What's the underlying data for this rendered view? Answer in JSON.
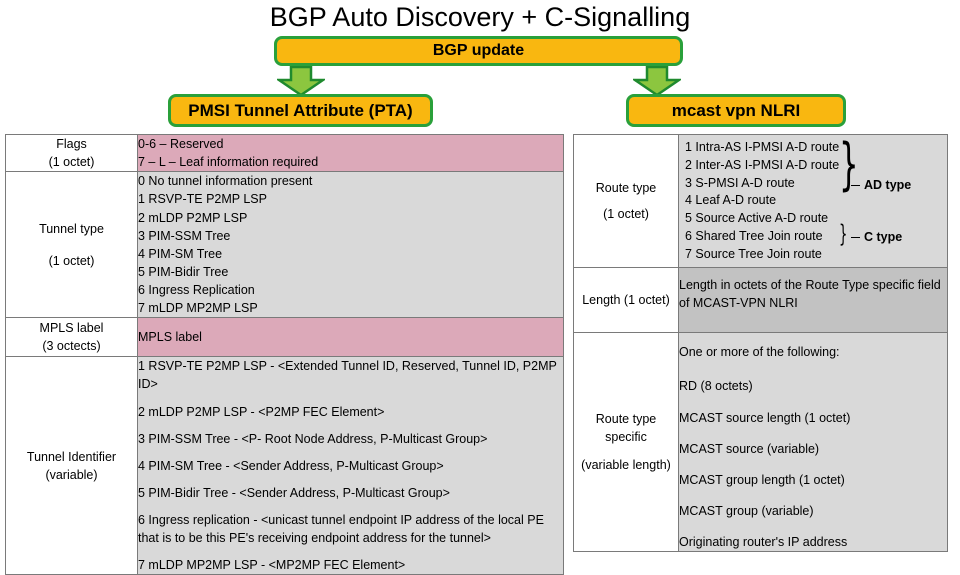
{
  "title": "BGP Auto Discovery + C-Signalling",
  "flow": {
    "root_label": "BGP update",
    "left_label": "PMSI Tunnel Attribute (PTA)",
    "right_label": "mcast vpn NLRI",
    "arrow_icon": "down-arrow-icon",
    "colors": {
      "box_fill": "#F9B710",
      "box_border": "#2AA03A",
      "arrow_fill": "#8CC63F",
      "arrow_border": "#2AA03A"
    }
  },
  "pta_table": {
    "name": "PMSI Tunnel Attribute fields",
    "rows": [
      {
        "field": "Flags",
        "size": "(1 octet)",
        "fill": "#DCA9B9",
        "lines": [
          "0-6 – Reserved",
          "7 – L – Leaf information  required"
        ]
      },
      {
        "field": "Tunnel type",
        "size": "(1 octet)",
        "fill": "#D9D9D9",
        "lines": [
          "0 No tunnel information  present",
          "1 RSVP-TE P2MP LSP",
          "2 mLDP P2MP LSP",
          "3 PIM-SSM Tree",
          "4 PIM-SM Tree",
          "5 PIM-Bidir Tree",
          "6 Ingress Replication",
          "7 mLDP MP2MP LSP"
        ]
      },
      {
        "field": "MPLS label",
        "size": "(3 octects)",
        "fill": "#DCA9B9",
        "lines": [
          "MPLS label"
        ]
      },
      {
        "field": "Tunnel Identifier",
        "size": "(variable)",
        "fill": "#D9D9D9",
        "lines": [
          "1  RSVP-TE P2MP LSP - <Extended Tunnel ID, Reserved, Tunnel ID, P2MP ID>",
          "2  mLDP P2MP LSP - <P2MP FEC Element>",
          "3  PIM-SSM Tree - <P- Root Node Address, P-Multicast Group>",
          "4  PIM-SM Tree - <Sender Address, P-Multicast Group>",
          "5  PIM-Bidir Tree - <Sender Address, P-Multicast Group>",
          "6  Ingress replication - <unicast tunnel endpoint IP address of the local PE that is to be this PE's receiving  endpoint  address for the tunnel>",
          "7  mLDP MP2MP LSP - <MP2MP FEC Element>"
        ]
      }
    ]
  },
  "nlri_table": {
    "name": "MCAST-VPN NLRI fields",
    "route_type": {
      "field": "Route type",
      "size": "(1 octet)",
      "fill": "#D9D9D9",
      "entries": [
        "1 Intra-AS I-PMSI A-D route",
        "2 Inter-AS I-PMSI A-D route",
        "3 S-PMSI A-D route",
        "4 Leaf A-D route",
        "5 Source Active A-D route",
        "6 Shared Tree Join route",
        "7 Source Tree Join route"
      ],
      "group_ad_label": "AD type",
      "group_c_label": "C type"
    },
    "length": {
      "field": "Length (1 octet)",
      "fill": "#C2C2C2",
      "lines": [
        "Length in octets of the Route Type specific field of MCAST-VPN NLRI"
      ]
    },
    "route_type_specific": {
      "field": "Route type specific",
      "size": "(variable  length)",
      "fill": "#D9D9D9",
      "intro": "One or more of the following:",
      "lines": [
        "RD (8 octets)",
        "MCAST source length (1 octet)",
        "MCAST source (variable)",
        "MCAST group length (1 octet)",
        "MCAST group (variable)",
        "Originating router's IP address"
      ]
    }
  }
}
